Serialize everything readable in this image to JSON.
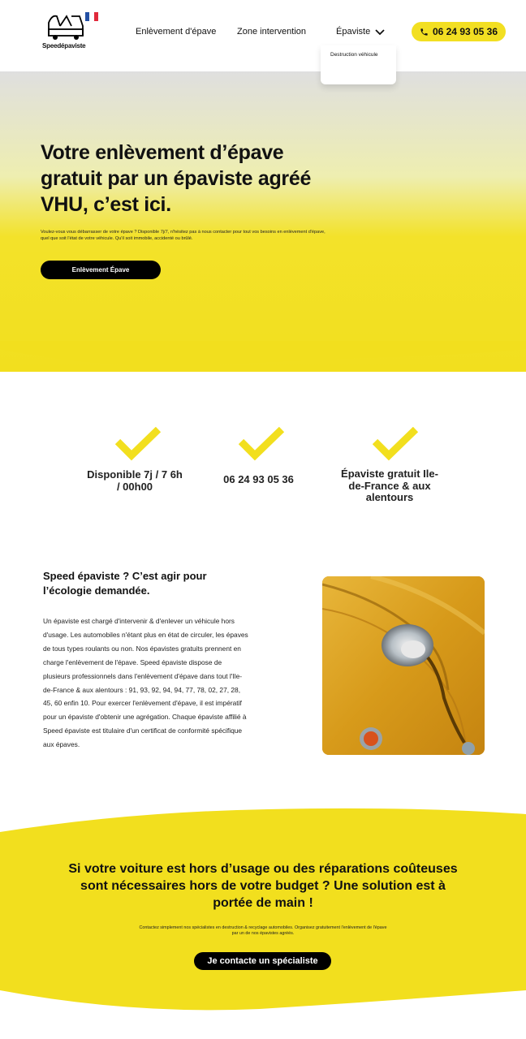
{
  "header": {
    "logo_text": "Speedépaviste",
    "nav": [
      {
        "label": "Enlèvement d'épave"
      },
      {
        "label": "Zone intervention"
      },
      {
        "label": "Épaviste"
      }
    ],
    "dropdown_item": "Destruction véhicule",
    "phone": "06 24 93 05 36"
  },
  "hero": {
    "title": "Votre enlèvement d’épave gratuit par un épaviste agréé VHU, c’est ici.",
    "text": "Voulez-vous vous débarrasser de votre épave ? Disponible 7j/7, n'hésitez pas à nous contacter pour tout vos besoins en enlèvement d'épave, quel que soit l'état de votre véhicule. Qu'il soit immobile, accidenté ou brûlé.",
    "button": "Enlèvement Épave"
  },
  "features": [
    {
      "text": "Disponible 7j / 7 6h / 00h00"
    },
    {
      "text": "06 24 93 05 36"
    },
    {
      "text": "Épaviste gratuit Ile-de-France & aux alentours"
    }
  ],
  "about": {
    "title": "Speed épaviste ? C’est agir pour l’écologie demandée.",
    "text": "Un épaviste est chargé d'intervenir & d'enlever un véhicule hors d'usage. Les automobiles n'étant plus en état de circuler, les épaves de tous types roulants ou non. Nos épavistes gratuits prennent en charge l'enlèvement de l'épave. Speed épaviste dispose de plusieurs professionnels dans l'enlèvement d'épave dans tout l'Ile-de-France & aux alentours : 91, 93, 92, 94, 94, 77, 78, 02, 27, 28, 45, 60 enfin 10. Pour exercer l'enlèvement d'épave, il est impératif pour un épaviste d'obtenir une agrégation. Chaque épaviste affilié à Speed épaviste est titulaire d'un certificat de conformité spécifique aux épaves."
  },
  "cta": {
    "title": "Si votre voiture est hors d’usage ou des réparations coûteuses sont nécessaires hors de votre budget ? Une solution est à portée de main !",
    "text": "Contactez simplement nos spécialistes en destruction & recyclage automobiles. Organisez gratuitement l'enlèvement de l'épave par un de nos épavistes agréés.",
    "button": "Je contacte un spécialiste"
  },
  "colors": {
    "accent": "#f2df1e",
    "dark": "#000000"
  }
}
